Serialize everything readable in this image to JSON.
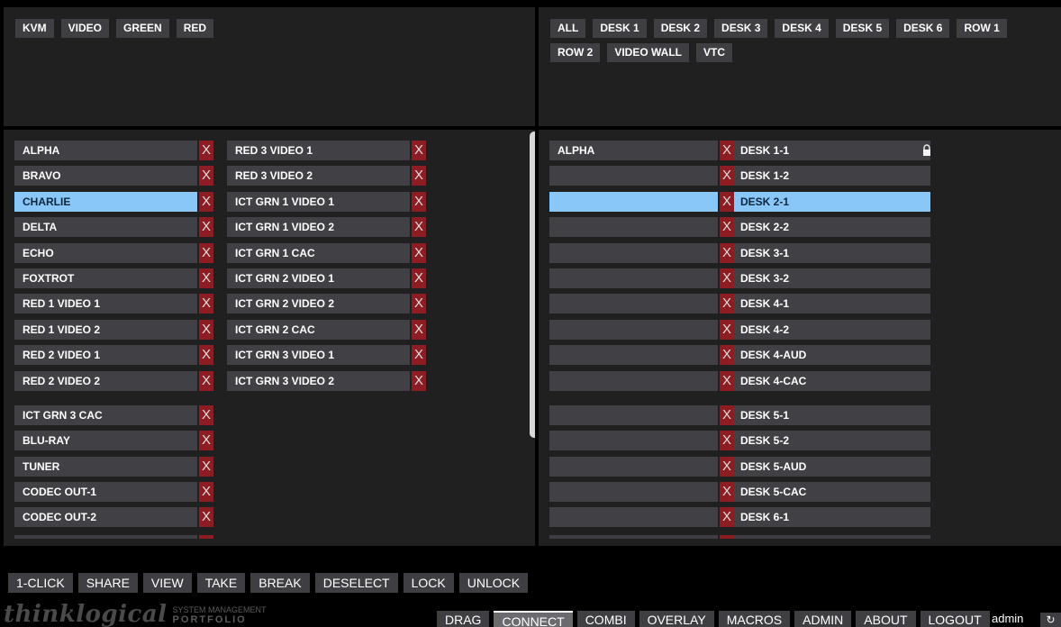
{
  "source_filters": [
    "KVM",
    "VIDEO",
    "GREEN",
    "RED"
  ],
  "destination_filters": [
    "ALL",
    "DESK 1",
    "DESK 2",
    "DESK 3",
    "DESK 4",
    "DESK 5",
    "DESK 6",
    "ROW 1",
    "ROW 2",
    "VIDEO WALL",
    "VTC"
  ],
  "sources_col1": [
    "ALPHA",
    "BRAVO",
    "CHARLIE",
    "DELTA",
    "ECHO",
    "FOXTROT",
    "RED 1 VIDEO 1",
    "RED 1 VIDEO 2",
    "RED 2 VIDEO 1",
    "RED 2 VIDEO 2",
    "ICT GRN 3 CAC",
    "BLU-RAY",
    "TUNER",
    "CODEC OUT-1",
    "CODEC OUT-2"
  ],
  "sources_col2": [
    "RED 3 VIDEO 1",
    "RED 3 VIDEO 2",
    "ICT GRN 1 VIDEO 1",
    "ICT GRN 1 VIDEO 2",
    "ICT GRN 1 CAC",
    "ICT GRN 2 VIDEO 1",
    "ICT GRN 2 VIDEO 2",
    "ICT GRN 2 CAC",
    "ICT GRN 3 VIDEO 1",
    "ICT GRN 3 VIDEO 2"
  ],
  "selected_source": "CHARLIE",
  "remove_glyph": "X",
  "destinations": [
    {
      "connected": "ALPHA",
      "name": "DESK 1-1",
      "locked": true
    },
    {
      "connected": "",
      "name": "DESK 1-2"
    },
    {
      "connected": "",
      "name": "DESK 2-1",
      "selected": true
    },
    {
      "connected": "",
      "name": "DESK 2-2"
    },
    {
      "connected": "",
      "name": "DESK 3-1"
    },
    {
      "connected": "",
      "name": "DESK 3-2"
    },
    {
      "connected": "",
      "name": "DESK 4-1"
    },
    {
      "connected": "",
      "name": "DESK 4-2"
    },
    {
      "connected": "",
      "name": "DESK 4-AUD"
    },
    {
      "connected": "",
      "name": "DESK 4-CAC"
    },
    {
      "connected": "",
      "name": "DESK 5-1"
    },
    {
      "connected": "",
      "name": "DESK 5-2"
    },
    {
      "connected": "",
      "name": "DESK 5-AUD"
    },
    {
      "connected": "",
      "name": "DESK 5-CAC"
    },
    {
      "connected": "",
      "name": "DESK 6-1"
    }
  ],
  "actions": [
    "1-CLICK",
    "SHARE",
    "VIEW",
    "TAKE",
    "BREAK",
    "DESELECT",
    "LOCK",
    "UNLOCK"
  ],
  "logo": {
    "name": "thinklogical",
    "line1": "SYSTEM MANAGEMENT",
    "line2": "PORTFOLIO"
  },
  "nav": [
    "DRAG",
    "CONNECT",
    "COMBI",
    "OVERLAY",
    "MACROS",
    "ADMIN",
    "ABOUT",
    "LOGOUT"
  ],
  "active_nav": "CONNECT",
  "user": "admin",
  "refresh_glyph": "↻",
  "icons": {
    "lock": "lock-icon",
    "refresh": "refresh-icon",
    "remove": "remove-icon"
  },
  "colors": {
    "selected": "#88c7f7",
    "remove": "#8d1d23",
    "item": "#404045",
    "panel": "#202020"
  }
}
